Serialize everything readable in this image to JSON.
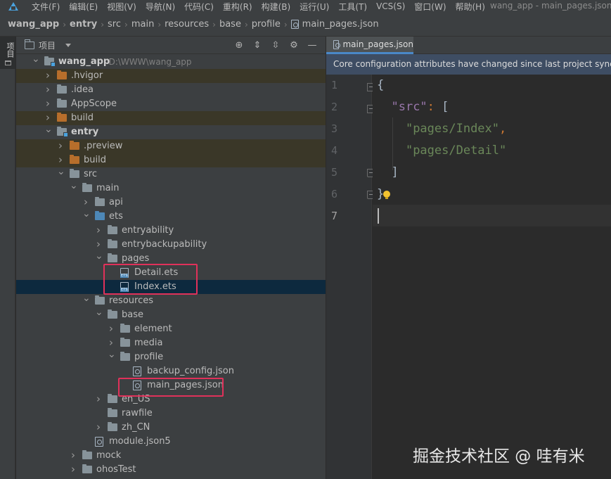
{
  "menubar": {
    "items": [
      "文件(F)",
      "编辑(E)",
      "视图(V)",
      "导航(N)",
      "代码(C)",
      "重构(R)",
      "构建(B)",
      "运行(U)",
      "工具(T)",
      "VCS(S)",
      "窗口(W)",
      "帮助(H)"
    ],
    "window_title": "wang_app - main_pages.json"
  },
  "breadcrumb": [
    "wang_app",
    "entry",
    "src",
    "main",
    "resources",
    "base",
    "profile",
    "main_pages.json"
  ],
  "tool_stripe": {
    "label": "项目"
  },
  "project_panel": {
    "title": "项目",
    "tree": [
      {
        "label": "wang_app",
        "hint": "D:\\WWW\\wang_app",
        "depth": 0,
        "arrow": "open",
        "icon": "module",
        "bold": true
      },
      {
        "label": ".hvigor",
        "depth": 1,
        "arrow": "closed",
        "icon": "orange",
        "excluded": true
      },
      {
        "label": ".idea",
        "depth": 1,
        "arrow": "closed",
        "icon": "gray"
      },
      {
        "label": "AppScope",
        "depth": 1,
        "arrow": "closed",
        "icon": "gray"
      },
      {
        "label": "build",
        "depth": 1,
        "arrow": "closed",
        "icon": "orange",
        "excluded": true
      },
      {
        "label": "entry",
        "depth": 1,
        "arrow": "open",
        "icon": "module",
        "bold": true
      },
      {
        "label": ".preview",
        "depth": 2,
        "arrow": "closed",
        "icon": "orange",
        "excluded": true
      },
      {
        "label": "build",
        "depth": 2,
        "arrow": "closed",
        "icon": "orange",
        "excluded": true
      },
      {
        "label": "src",
        "depth": 2,
        "arrow": "open",
        "icon": "gray"
      },
      {
        "label": "main",
        "depth": 3,
        "arrow": "open",
        "icon": "gray"
      },
      {
        "label": "api",
        "depth": 4,
        "arrow": "closed",
        "icon": "gray"
      },
      {
        "label": "ets",
        "depth": 4,
        "arrow": "open",
        "icon": "blue"
      },
      {
        "label": "entryability",
        "depth": 5,
        "arrow": "closed",
        "icon": "gray"
      },
      {
        "label": "entrybackupability",
        "depth": 5,
        "arrow": "closed",
        "icon": "gray"
      },
      {
        "label": "pages",
        "depth": 5,
        "arrow": "open",
        "icon": "gray"
      },
      {
        "label": "Detail.ets",
        "depth": 6,
        "arrow": "none",
        "icon": "ets"
      },
      {
        "label": "Index.ets",
        "depth": 6,
        "arrow": "none",
        "icon": "ets",
        "selected": true
      },
      {
        "label": "resources",
        "depth": 4,
        "arrow": "open",
        "icon": "gray"
      },
      {
        "label": "base",
        "depth": 5,
        "arrow": "open",
        "icon": "gray"
      },
      {
        "label": "element",
        "depth": 6,
        "arrow": "closed",
        "icon": "gray"
      },
      {
        "label": "media",
        "depth": 6,
        "arrow": "closed",
        "icon": "gray"
      },
      {
        "label": "profile",
        "depth": 6,
        "arrow": "open",
        "icon": "gray"
      },
      {
        "label": "backup_config.json",
        "depth": 7,
        "arrow": "none",
        "icon": "json"
      },
      {
        "label": "main_pages.json",
        "depth": 7,
        "arrow": "none",
        "icon": "json"
      },
      {
        "label": "en_US",
        "depth": 5,
        "arrow": "closed",
        "icon": "gray"
      },
      {
        "label": "rawfile",
        "depth": 5,
        "arrow": "none",
        "icon": "gray"
      },
      {
        "label": "zh_CN",
        "depth": 5,
        "arrow": "closed",
        "icon": "gray"
      },
      {
        "label": "module.json5",
        "depth": 4,
        "arrow": "none",
        "icon": "json"
      },
      {
        "label": "mock",
        "depth": 3,
        "arrow": "closed",
        "icon": "gray"
      },
      {
        "label": "ohosTest",
        "depth": 3,
        "arrow": "closed",
        "icon": "gray"
      }
    ]
  },
  "editor": {
    "tab_label": "main_pages.json",
    "banner": "Core configuration attributes have changed since last project sync. A",
    "line_numbers": [
      "1",
      "2",
      "3",
      "4",
      "5",
      "6",
      "7"
    ],
    "code": {
      "l1_brace": "{",
      "l2_key": "\"src\"",
      "l2_colon": ":",
      "l2_bracket": "[",
      "l3_str": "\"pages/Index\"",
      "l3_comma": ",",
      "l4_str": "\"pages/Detail\"",
      "l5_bracket": "]",
      "l6_brace": "}"
    }
  },
  "watermark": "掘金技术社区 @ 哇有米",
  "colors": {
    "highlight_box": "#e0315a",
    "selection": "#0d293e",
    "banner": "#3e4d63",
    "json_key": "#9876aa",
    "json_string": "#6a8759"
  }
}
